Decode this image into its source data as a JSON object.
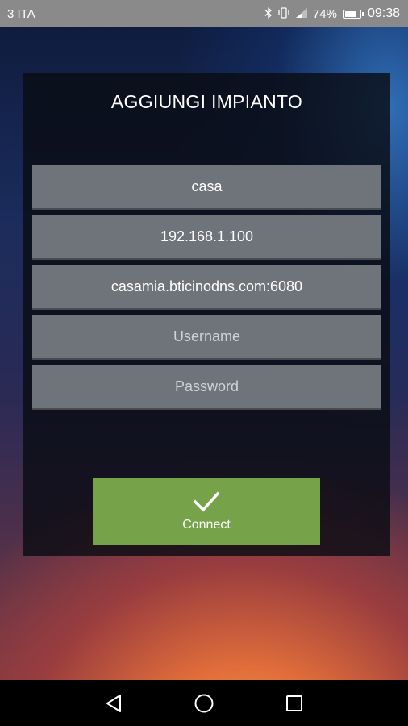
{
  "status_bar": {
    "carrier": "3 ITA",
    "battery_percent": "74%",
    "battery_level": 0.74,
    "time": "09:38",
    "icons": [
      "bluetooth-icon",
      "vibrate-icon",
      "signal-icon"
    ]
  },
  "dialog": {
    "title": "AGGIUNGI IMPIANTO",
    "fields": {
      "name": {
        "value": "casa"
      },
      "local_ip": {
        "value": "192.168.1.100"
      },
      "remote_address": {
        "value": "casamia.bticinodns.com:6080"
      },
      "username": {
        "value": "",
        "placeholder": "Username"
      },
      "password": {
        "value": "",
        "placeholder": "Password"
      }
    },
    "connect_button": {
      "label": "Connect",
      "icon": "check-icon"
    }
  },
  "nav_bar": {
    "icons": [
      "back-icon",
      "home-icon",
      "recents-icon"
    ]
  },
  "colors": {
    "button_green": "#76a24a",
    "field_gray": "#6f737a",
    "status_bar_gray": "#8a8a8a"
  }
}
